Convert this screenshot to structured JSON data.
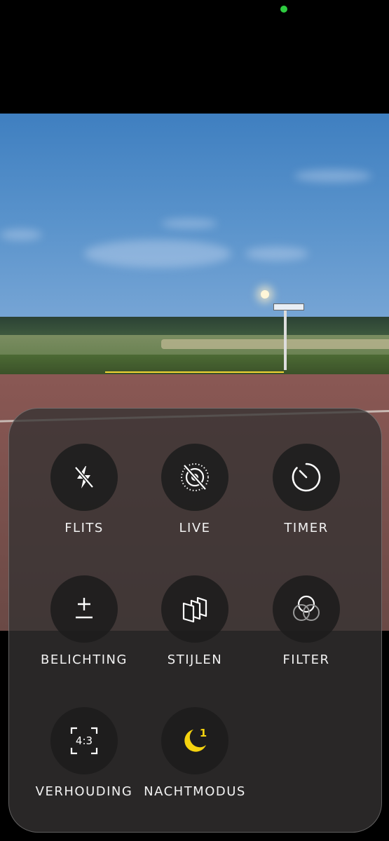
{
  "controls": [
    {
      "id": "flash",
      "label": "FLITS",
      "icon": "flash-off-icon"
    },
    {
      "id": "live",
      "label": "LIVE",
      "icon": "live-photo-off-icon"
    },
    {
      "id": "timer",
      "label": "TIMER",
      "icon": "timer-icon"
    },
    {
      "id": "exposure",
      "label": "BELICHTING",
      "icon": "exposure-icon"
    },
    {
      "id": "styles",
      "label": "STIJLEN",
      "icon": "photographic-styles-icon"
    },
    {
      "id": "filter",
      "label": "FILTER",
      "icon": "filter-icon"
    },
    {
      "id": "aspect",
      "label": "VERHOUDING",
      "icon": "aspect-ratio-icon",
      "value": "4:3"
    },
    {
      "id": "night",
      "label": "NACHTMODUS",
      "icon": "night-mode-icon",
      "value": "1"
    }
  ],
  "colors": {
    "accent_yellow": "#f5d30f",
    "status_green": "#2ecc40",
    "panel_bg": "#343232"
  }
}
